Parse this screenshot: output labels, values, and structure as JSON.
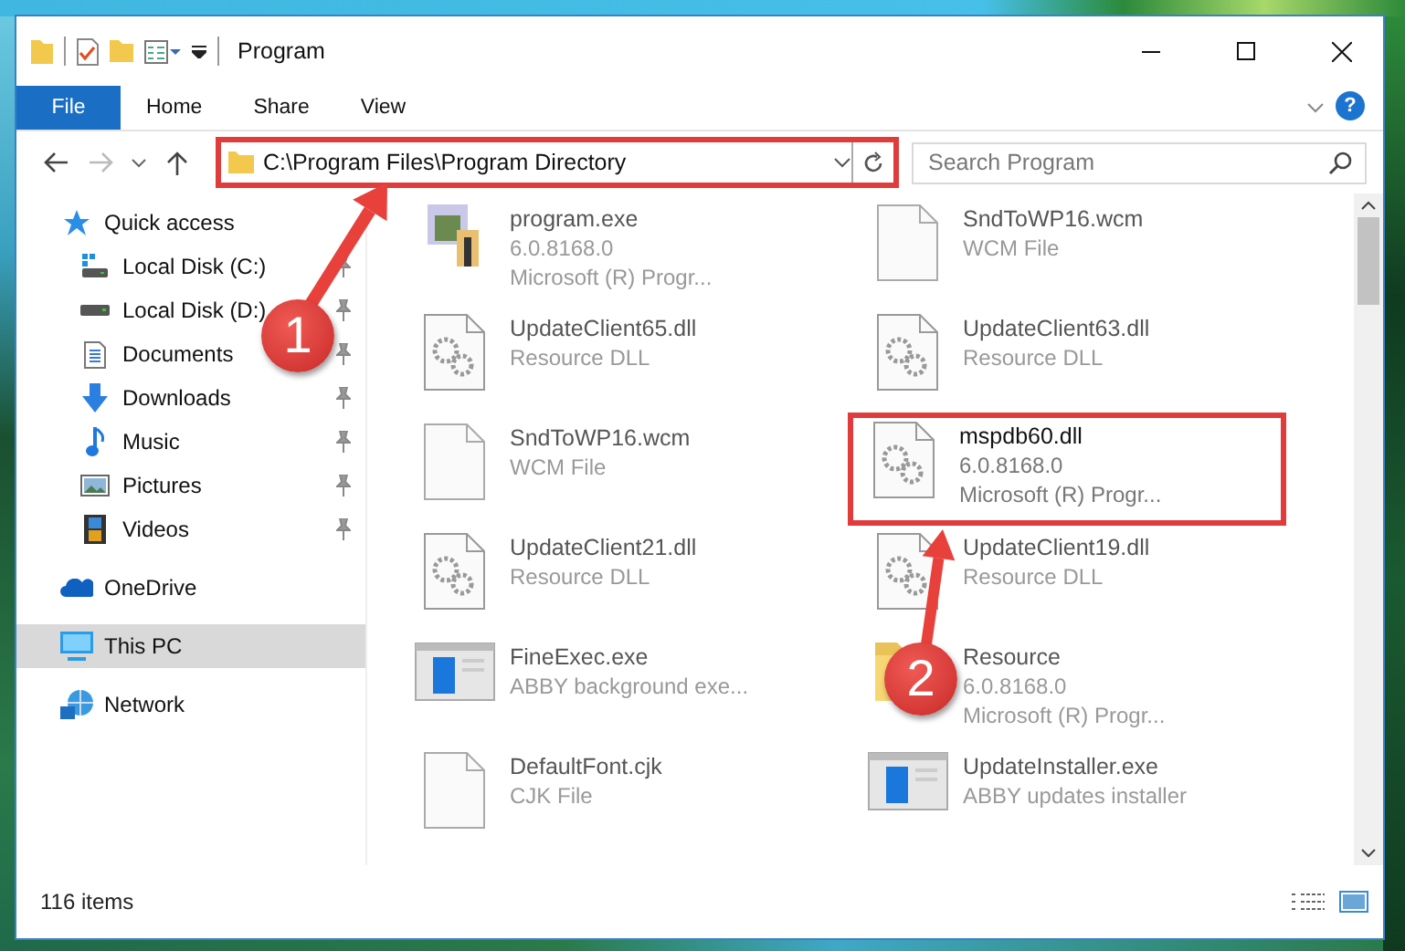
{
  "window": {
    "title": "Program"
  },
  "ribbon_tabs": [
    {
      "label": "File",
      "kind": "file_menu"
    },
    {
      "label": "Home",
      "kind": "tab"
    },
    {
      "label": "Share",
      "kind": "tab"
    },
    {
      "label": "View",
      "kind": "tab"
    }
  ],
  "help": "?",
  "address_bar": {
    "path": "C:\\Program Files\\Program Directory",
    "highlighted": true
  },
  "search": {
    "placeholder": "Search Program"
  },
  "sidebar": {
    "items": [
      {
        "label": "Quick access",
        "kind": "star",
        "selected": false,
        "children": [
          {
            "label": "Local Disk (C:)",
            "kind": "drive_c",
            "pinned": true,
            "selected": false
          },
          {
            "label": "Local Disk (D:)",
            "kind": "drive",
            "pinned": true,
            "selected": false
          },
          {
            "label": "Documents",
            "kind": "documents",
            "pinned": true,
            "selected": false
          },
          {
            "label": "Downloads",
            "kind": "downloads",
            "pinned": true,
            "selected": false
          },
          {
            "label": "Music",
            "kind": "music",
            "pinned": true,
            "selected": false
          },
          {
            "label": "Pictures",
            "kind": "pictures",
            "pinned": true,
            "selected": false
          },
          {
            "label": "Videos",
            "kind": "videos",
            "pinned": true,
            "selected": false
          }
        ]
      },
      {
        "label": "OneDrive",
        "kind": "cloud",
        "selected": false
      },
      {
        "label": "This PC",
        "kind": "pc",
        "selected": true
      },
      {
        "label": "Network",
        "kind": "network",
        "selected": false
      }
    ]
  },
  "files": [
    {
      "name": "program.exe",
      "details": [
        "6.0.8168.0",
        "Microsoft (R) Progr..."
      ],
      "kind": "app",
      "highlighted": false
    },
    {
      "name": "SndToWP16.wcm",
      "details": [
        "WCM File"
      ],
      "kind": "blank",
      "highlighted": false
    },
    {
      "name": "UpdateClient65.dll",
      "details": [
        "Resource DLL"
      ],
      "kind": "dll",
      "highlighted": false
    },
    {
      "name": "UpdateClient63.dll",
      "details": [
        "Resource DLL"
      ],
      "kind": "dll",
      "highlighted": false
    },
    {
      "name": "SndToWP16.wcm",
      "details": [
        "WCM File"
      ],
      "kind": "blank",
      "highlighted": false
    },
    {
      "name": "mspdb60.dll",
      "details": [
        "6.0.8168.0",
        "Microsoft (R) Progr..."
      ],
      "kind": "dll",
      "highlighted": true
    },
    {
      "name": "UpdateClient21.dll",
      "details": [
        "Resource DLL"
      ],
      "kind": "dll",
      "highlighted": false
    },
    {
      "name": "UpdateClient19.dll",
      "details": [
        "Resource DLL"
      ],
      "kind": "dll",
      "highlighted": false
    },
    {
      "name": "FineExec.exe",
      "details": [
        "ABBY background exe..."
      ],
      "kind": "window",
      "highlighted": false
    },
    {
      "name": "Resource",
      "details": [
        "6.0.8168.0",
        "Microsoft (R) Progr..."
      ],
      "kind": "folder",
      "highlighted": false
    },
    {
      "name": "DefaultFont.cjk",
      "details": [
        "CJK File"
      ],
      "kind": "blank",
      "highlighted": false
    },
    {
      "name": "UpdateInstaller.exe",
      "details": [
        "ABBY updates installer"
      ],
      "kind": "window",
      "highlighted": false
    }
  ],
  "status_bar": {
    "item_count": "116 items"
  },
  "annotations": [
    {
      "number": "1"
    },
    {
      "number": "2"
    }
  ]
}
